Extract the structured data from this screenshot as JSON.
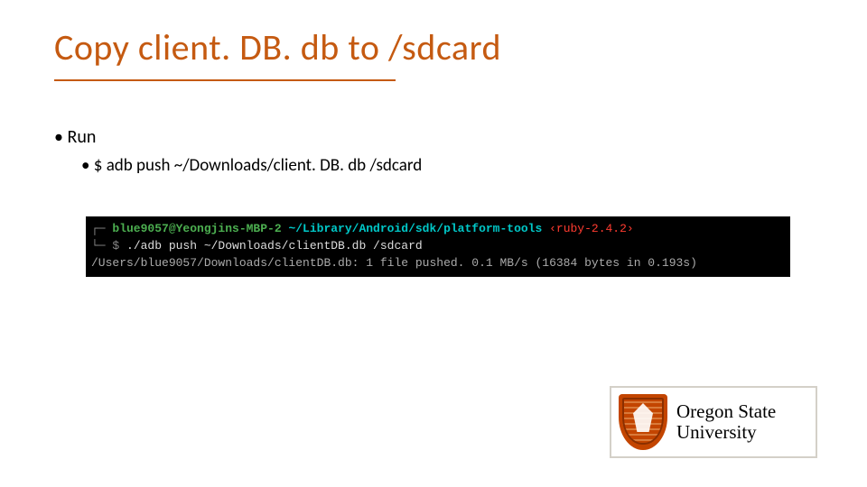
{
  "title": "Copy client. DB. db to /sdcard",
  "bullets": {
    "level1": "Run",
    "level2": "$ adb push ~/Downloads/client. DB. db /sdcard"
  },
  "terminal": {
    "prompt_open": "┌─ ",
    "user": "blue9057@Yeongjins-MBP-2",
    "path": " ~/Library/Android/sdk/platform-tools ",
    "ruby": "‹ruby-2.4.2›",
    "prompt2": "└─ $ ",
    "cmd": "./adb push ~/Downloads/clientDB.db /sdcard",
    "out": "/Users/blue9057/Downloads/clientDB.db: 1 file pushed. 0.1 MB/s (16384 bytes in 0.193s)"
  },
  "logo": {
    "line1": "Oregon State",
    "line2": "University"
  }
}
